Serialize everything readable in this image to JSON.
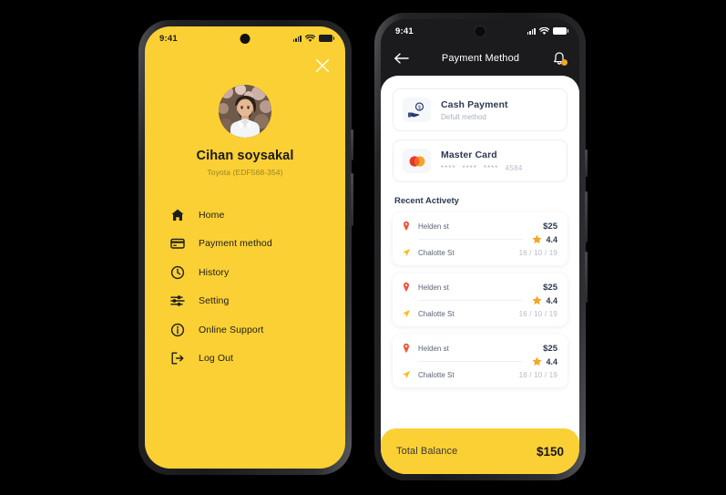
{
  "canvas": {
    "background": "#000000"
  },
  "theme": {
    "yellow": "#FBD034",
    "dark": "#1B1B1D",
    "navy": "#2B3A52",
    "muted": "#A9B0C0",
    "star": "#F5A623",
    "pin": "#F4543C"
  },
  "left_phone": {
    "status_bar": {
      "time": "9:41",
      "signal_icon": "signal-bars-icon",
      "wifi_icon": "wifi-icon",
      "battery_icon": "battery-icon"
    },
    "close_icon": "close-icon",
    "profile": {
      "avatar_icon": "user-avatar-photo",
      "name": "Cihan soysakal",
      "vehicle": "Toyota (EDF568-354)"
    },
    "menu": [
      {
        "icon": "home-icon",
        "label": "Home"
      },
      {
        "icon": "credit-card-icon",
        "label": "Payment method"
      },
      {
        "icon": "clock-icon",
        "label": "History"
      },
      {
        "icon": "sliders-icon",
        "label": "Setting"
      },
      {
        "icon": "info-circle-icon",
        "label": "Online Support"
      },
      {
        "icon": "logout-icon",
        "label": "Log Out"
      }
    ]
  },
  "right_phone": {
    "status_bar": {
      "time": "9:41",
      "signal_icon": "signal-bars-icon",
      "wifi_icon": "wifi-icon",
      "battery_icon": "battery-icon"
    },
    "appbar": {
      "back_icon": "back-arrow-icon",
      "title": "Payment Method",
      "bell_icon": "bell-icon",
      "bell_badge": true
    },
    "payment_methods": [
      {
        "logo": "cash-hand-icon",
        "title": "Cash Payment",
        "subtitle": "Defult method",
        "type": "cash"
      },
      {
        "logo": "mastercard-icon",
        "title": "Master Card",
        "masked": [
          "****",
          "****",
          "****"
        ],
        "last4": "4584",
        "type": "card"
      }
    ],
    "recent_activity": {
      "title": "Recent Activety",
      "items": [
        {
          "pickup_icon": "map-pin-icon",
          "pickup": "Helden st",
          "dropoff_icon": "navigation-arrow-icon",
          "dropoff": "Chalotte St",
          "amount": "$25",
          "rating_icon": "star-icon",
          "rating": "4.4",
          "date": "16 / 10 / 19"
        },
        {
          "pickup_icon": "map-pin-icon",
          "pickup": "Helden st",
          "dropoff_icon": "navigation-arrow-icon",
          "dropoff": "Chalotte St",
          "amount": "$25",
          "rating_icon": "star-icon",
          "rating": "4.4",
          "date": "16 / 10 / 19"
        },
        {
          "pickup_icon": "map-pin-icon",
          "pickup": "Helden st",
          "dropoff_icon": "navigation-arrow-icon",
          "dropoff": "Chalotte St",
          "amount": "$25",
          "rating_icon": "star-icon",
          "rating": "4.4",
          "date": "16 / 10 / 19"
        }
      ]
    },
    "balance": {
      "label": "Total Balance",
      "value": "$150"
    }
  }
}
